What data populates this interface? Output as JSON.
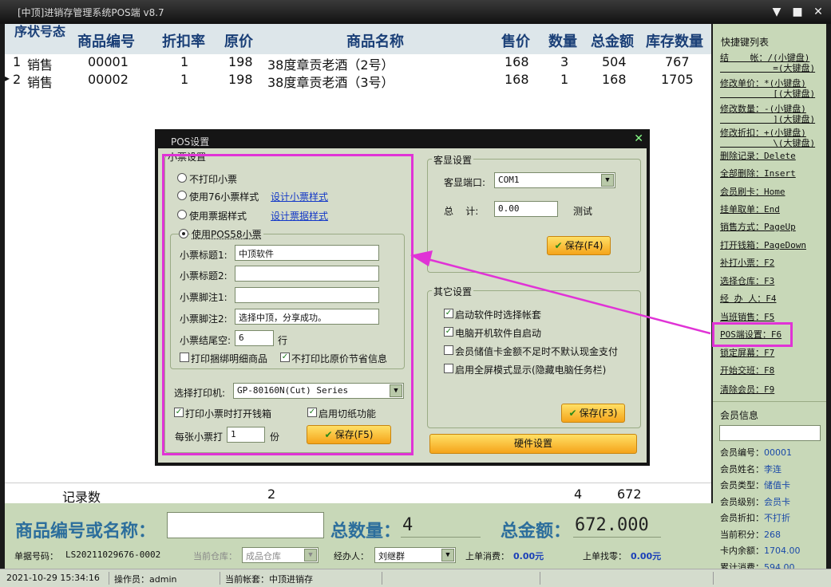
{
  "window": {
    "title": "[中顶]进销存管理系统POS端 v8.7",
    "min": "▼",
    "max": "■",
    "close": "✕"
  },
  "grid": {
    "headers": {
      "status": "序状号态",
      "code": "商品编号",
      "discount": "折扣率",
      "orig_price": "原价",
      "name": "商品名称",
      "price": "售价",
      "qty": "数量",
      "amount": "总金额",
      "stock": "库存数量"
    },
    "rows": [
      {
        "marker": "",
        "no": "1",
        "status": "销售",
        "code": "00001",
        "discount": "1",
        "orig_price": "198",
        "name": "38度章贡老酒（2号）",
        "price": "168",
        "qty": "3",
        "amount": "504",
        "stock": "767"
      },
      {
        "marker": "▸",
        "no": "2",
        "status": "销售",
        "code": "00002",
        "discount": "1",
        "orig_price": "198",
        "name": "38度章贡老酒（3号）",
        "price": "168",
        "qty": "1",
        "amount": "168",
        "stock": "1705"
      }
    ],
    "totals": {
      "label": "记录数",
      "count": "2",
      "qty": "4",
      "amount": "672"
    }
  },
  "sidebar": {
    "title": "快捷键列表",
    "keys": [
      "结    帐：/(小键盘)\n          =(大键盘)",
      "修改单价：*(小键盘)\n          [(大键盘)",
      "修改数量：-(小键盘)\n          ](大键盘)",
      "修改折扣：+(小键盘)\n          \\(大键盘)",
      "删除记录：Delete",
      "全部删除：Insert",
      "会员刷卡：Home",
      "挂单取单：End",
      "销售方式：PageUp",
      "打开钱箱：PageDown",
      "补打小票：F2",
      "选择仓库：F3",
      "经 办 人：F4",
      "当班销售：F5",
      "POS端设置：F6",
      "锁定屏幕：F7",
      "开始交班：F8",
      "清除会员：F9"
    ],
    "member_title": "会员信息",
    "member_search": "",
    "member": [
      {
        "k": "会员编号：",
        "v": "00001"
      },
      {
        "k": "会员姓名：",
        "v": "李连"
      },
      {
        "k": "会员类型：",
        "v": "储值卡"
      },
      {
        "k": "会员级别：",
        "v": "会员卡"
      },
      {
        "k": "会员折扣：",
        "v": "不打折"
      },
      {
        "k": "当前积分：",
        "v": "268"
      },
      {
        "k": "卡内余额：",
        "v": "1704.00"
      },
      {
        "k": "累计消费：",
        "v": "594.00"
      }
    ]
  },
  "bottom": {
    "search_label": "商品编号或名称：",
    "search_value": "",
    "qty_label": "总数量：",
    "qty_value": "4",
    "amount_label": "总金额：",
    "amount_value": "672.000",
    "bill_label": "单据号码：",
    "bill_value": "LS20211029676-0002",
    "warehouse_label": "当前仓库：",
    "warehouse_value": "成品仓库",
    "agent_label": "经办人：",
    "agent_value": "刘继群",
    "last_spend_label": "上单消费：",
    "last_spend_value": "0.00元",
    "last_change_label": "上单找零：",
    "last_change_value": "0.00元"
  },
  "status": {
    "datetime": "2021-10-29 15:34:16",
    "operator": "操作员：admin",
    "account": "当前帐套：中顶进销存"
  },
  "dialog": {
    "title": "POS设置",
    "close": "✕",
    "receipt": {
      "group": "小票设置",
      "opt_none": "不打印小票",
      "opt_76": "使用76小票样式",
      "link_design_receipt": "设计小票样式",
      "opt_bill": "使用票据样式",
      "link_design_bill": "设计票据样式",
      "opt_58": "使用POS58小票",
      "title1_label": "小票标题1:",
      "title1_value": "中顶软件",
      "title2_label": "小票标题2:",
      "title2_value": "",
      "footer1_label": "小票脚注1:",
      "footer1_value": "",
      "footer2_label": "小票脚注2:",
      "footer2_value": "选择中顶，分享成功。",
      "tail_label": "小票结尾空:",
      "tail_value": "6",
      "tail_unit": "行",
      "cb_bundle": "打印捆绑明细商品",
      "cb_noorig": "不打印比原价节省信息",
      "printer_label": "选择打印机:",
      "printer_value": "GP-80160N(Cut) Series",
      "cb_drawer": "打印小票时打开钱箱",
      "cb_cut": "启用切纸功能",
      "copies_label": "每张小票打",
      "copies_value": "1",
      "copies_unit": "份",
      "save": "保存(F5)"
    },
    "display": {
      "group": "客显设置",
      "port_label": "客显端口:",
      "port_value": "COM1",
      "total_label": "总    计:",
      "total_value": "0.00",
      "test": "测试",
      "save": "保存(F4)"
    },
    "other": {
      "group": "其它设置",
      "cb1": "启动软件时选择帐套",
      "cb2": "电脑开机软件自启动",
      "cb3": "会员储值卡金额不足时不默认现金支付",
      "cb4": "启用全屏模式显示(隐藏电脑任务栏)",
      "save": "保存(F3)"
    },
    "hardware": "硬件设置"
  },
  "colors": {
    "annotation": "#e033d6",
    "accent_button": "#f5a41a",
    "panel": "#c8d8b8"
  }
}
